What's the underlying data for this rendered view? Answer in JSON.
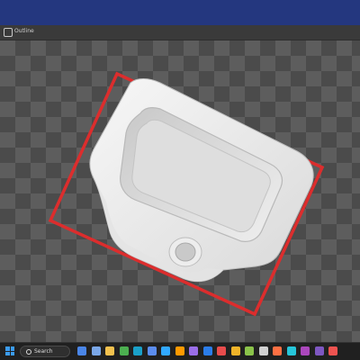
{
  "window": {
    "titlebar_color": "#24377f"
  },
  "toolbar": {
    "checkbox_label": "Outline"
  },
  "viewport": {
    "checker_light": "#5d5d5d",
    "checker_dark": "#4b4b4b",
    "bounding_box_color": "#dc2d2d",
    "model_color": "#f2f2f2"
  },
  "taskbar": {
    "search_label": "Search",
    "apps": [
      {
        "icon": "widgets-icon",
        "color": "#4a86e8"
      },
      {
        "icon": "task-view-icon",
        "color": "#7aa7e8"
      },
      {
        "icon": "file-explorer-icon",
        "color": "#f2c14e"
      },
      {
        "icon": "chrome-icon",
        "color": "#4caf50"
      },
      {
        "icon": "edge-icon",
        "color": "#1aa0c8"
      },
      {
        "icon": "store-icon",
        "color": "#5b8def"
      },
      {
        "icon": "photoshop-icon",
        "color": "#31a8ff"
      },
      {
        "icon": "illustrator-icon",
        "color": "#ff9a00"
      },
      {
        "icon": "app-icon",
        "color": "#9a6ee8"
      },
      {
        "icon": "mail-icon",
        "color": "#2b7de9"
      },
      {
        "icon": "app-icon-2",
        "color": "#e84c4c"
      },
      {
        "icon": "browser-icon",
        "color": "#f0b429"
      },
      {
        "icon": "app-icon-3",
        "color": "#8bc34a"
      },
      {
        "icon": "app-icon-4",
        "color": "#d0d0d0"
      },
      {
        "icon": "app-icon-5",
        "color": "#ff7043"
      },
      {
        "icon": "app-icon-6",
        "color": "#26c6da"
      },
      {
        "icon": "app-icon-7",
        "color": "#ab47bc"
      },
      {
        "icon": "app-icon-8",
        "color": "#7e57c2"
      },
      {
        "icon": "app-icon-9",
        "color": "#ef5350"
      }
    ]
  }
}
